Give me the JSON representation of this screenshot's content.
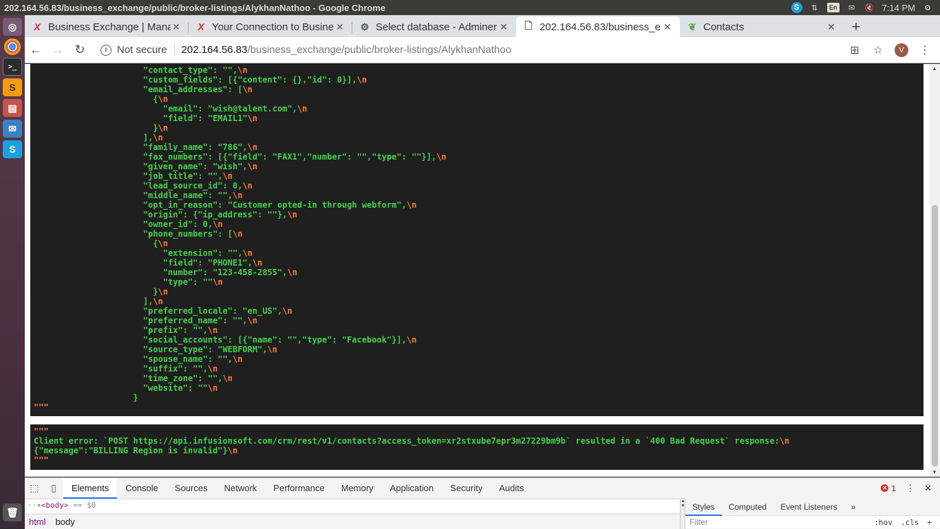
{
  "os": {
    "window_title": "202.164.56.83/business_exchange/public/broker-listings/AlykhanNathoo - Google Chrome",
    "tray_lang": "En",
    "clock": "7:14 PM"
  },
  "tabs": [
    {
      "label": "Business Exchange | Mana",
      "icon": "x-logo-icon"
    },
    {
      "label": "Your Connection to Busine",
      "icon": "x-logo-icon"
    },
    {
      "label": "Select database - Adminer",
      "icon": "adminer-icon"
    },
    {
      "label": "202.164.56.83/business_e",
      "icon": "page-icon"
    },
    {
      "label": "Contacts",
      "icon": "leaf-icon"
    }
  ],
  "address": {
    "security_label": "Not secure",
    "host": "202.164.56.83",
    "path": "/business_exchange/public/broker-listings/AlykhanNathoo",
    "profile_initial": "V"
  },
  "dump_lines": [
    {
      "indent": 22,
      "text": "\"contact_type\": \"\",",
      "nl": true
    },
    {
      "indent": 22,
      "text": "\"custom_fields\": [{\"content\": {},\"id\": 0}],",
      "nl": true
    },
    {
      "indent": 22,
      "text": "\"email_addresses\": [",
      "nl": true
    },
    {
      "indent": 24,
      "text": "{",
      "nl": true
    },
    {
      "indent": 26,
      "text": "\"email\": \"wish@talent.com\",",
      "nl": true
    },
    {
      "indent": 26,
      "text": "\"field\": \"EMAIL1\"",
      "nl": true
    },
    {
      "indent": 24,
      "text": "}",
      "nl": true
    },
    {
      "indent": 22,
      "text": "],",
      "nl": true
    },
    {
      "indent": 22,
      "text": "\"family_name\": \"786\",",
      "nl": true
    },
    {
      "indent": 22,
      "text": "\"fax_numbers\": [{\"field\": \"FAX1\",\"number\": \"\",\"type\": \"\"}],",
      "nl": true
    },
    {
      "indent": 22,
      "text": "\"given_name\": \"wish\",",
      "nl": true
    },
    {
      "indent": 22,
      "text": "\"job_title\": \"\",",
      "nl": true
    },
    {
      "indent": 22,
      "text": "\"lead_source_id\": 0,",
      "nl": true
    },
    {
      "indent": 22,
      "text": "\"middle_name\": \"\",",
      "nl": true
    },
    {
      "indent": 22,
      "text": "\"opt_in_reason\": \"Customer opted-in through webform\",",
      "nl": true
    },
    {
      "indent": 22,
      "text": "\"origin\": {\"ip_address\": \"\"},",
      "nl": true
    },
    {
      "indent": 22,
      "text": "\"owner_id\": 0,",
      "nl": true
    },
    {
      "indent": 22,
      "text": "\"phone_numbers\": [",
      "nl": true
    },
    {
      "indent": 24,
      "text": "{",
      "nl": true
    },
    {
      "indent": 26,
      "text": "\"extension\": \"\",",
      "nl": true
    },
    {
      "indent": 26,
      "text": "\"field\": \"PHONE1\",",
      "nl": true
    },
    {
      "indent": 26,
      "text": "\"number\": \"123-458-2855\",",
      "nl": true
    },
    {
      "indent": 26,
      "text": "\"type\": \"\"",
      "nl": true
    },
    {
      "indent": 24,
      "text": "}",
      "nl": true
    },
    {
      "indent": 22,
      "text": "],",
      "nl": true
    },
    {
      "indent": 22,
      "text": "\"preferred_locale\": \"en_US\",",
      "nl": true
    },
    {
      "indent": 22,
      "text": "\"preferred_name\": \"\",",
      "nl": true
    },
    {
      "indent": 22,
      "text": "\"prefix\": \"\",",
      "nl": true
    },
    {
      "indent": 22,
      "text": "\"social_accounts\": [{\"name\": \"\",\"type\": \"Facebook\"}],",
      "nl": true
    },
    {
      "indent": 22,
      "text": "\"source_type\": \"WEBFORM\",",
      "nl": true
    },
    {
      "indent": 22,
      "text": "\"spouse_name\": \"\",",
      "nl": true
    },
    {
      "indent": 22,
      "text": "\"suffix\": \"\",",
      "nl": true
    },
    {
      "indent": 22,
      "text": "\"time_zone\": \"\",",
      "nl": true
    },
    {
      "indent": 22,
      "text": "\"website\": \"\"",
      "nl": true
    },
    {
      "indent": 20,
      "text": "}",
      "nl": false
    }
  ],
  "dump_close": "\"\"\"",
  "error": {
    "open": "\"\"\"",
    "line1": "Client error: `POST https://api.infusionsoft.com/crm/rest/v1/contacts?access_token=xr2stxube7epr3m27229bm9b` resulted in a `400 Bad Request` response:",
    "line2": "{\"message\":\"BILLING Region is invalid\"}",
    "close": "\"\"\"",
    "nl": "\\n"
  },
  "devtools": {
    "tabs": [
      "Elements",
      "Console",
      "Sources",
      "Network",
      "Performance",
      "Memory",
      "Application",
      "Security",
      "Audits"
    ],
    "active_tab": "Elements",
    "error_count": "1",
    "selected_node": "<body>",
    "selected_var": "== $0",
    "crumb_html": "html",
    "crumb_body": "body",
    "side_tabs": [
      "Styles",
      "Computed",
      "Event Listeners"
    ],
    "side_more": "»",
    "filter_placeholder": "Filter",
    "hov": ":hov",
    "cls": ".cls",
    "add": "+"
  }
}
